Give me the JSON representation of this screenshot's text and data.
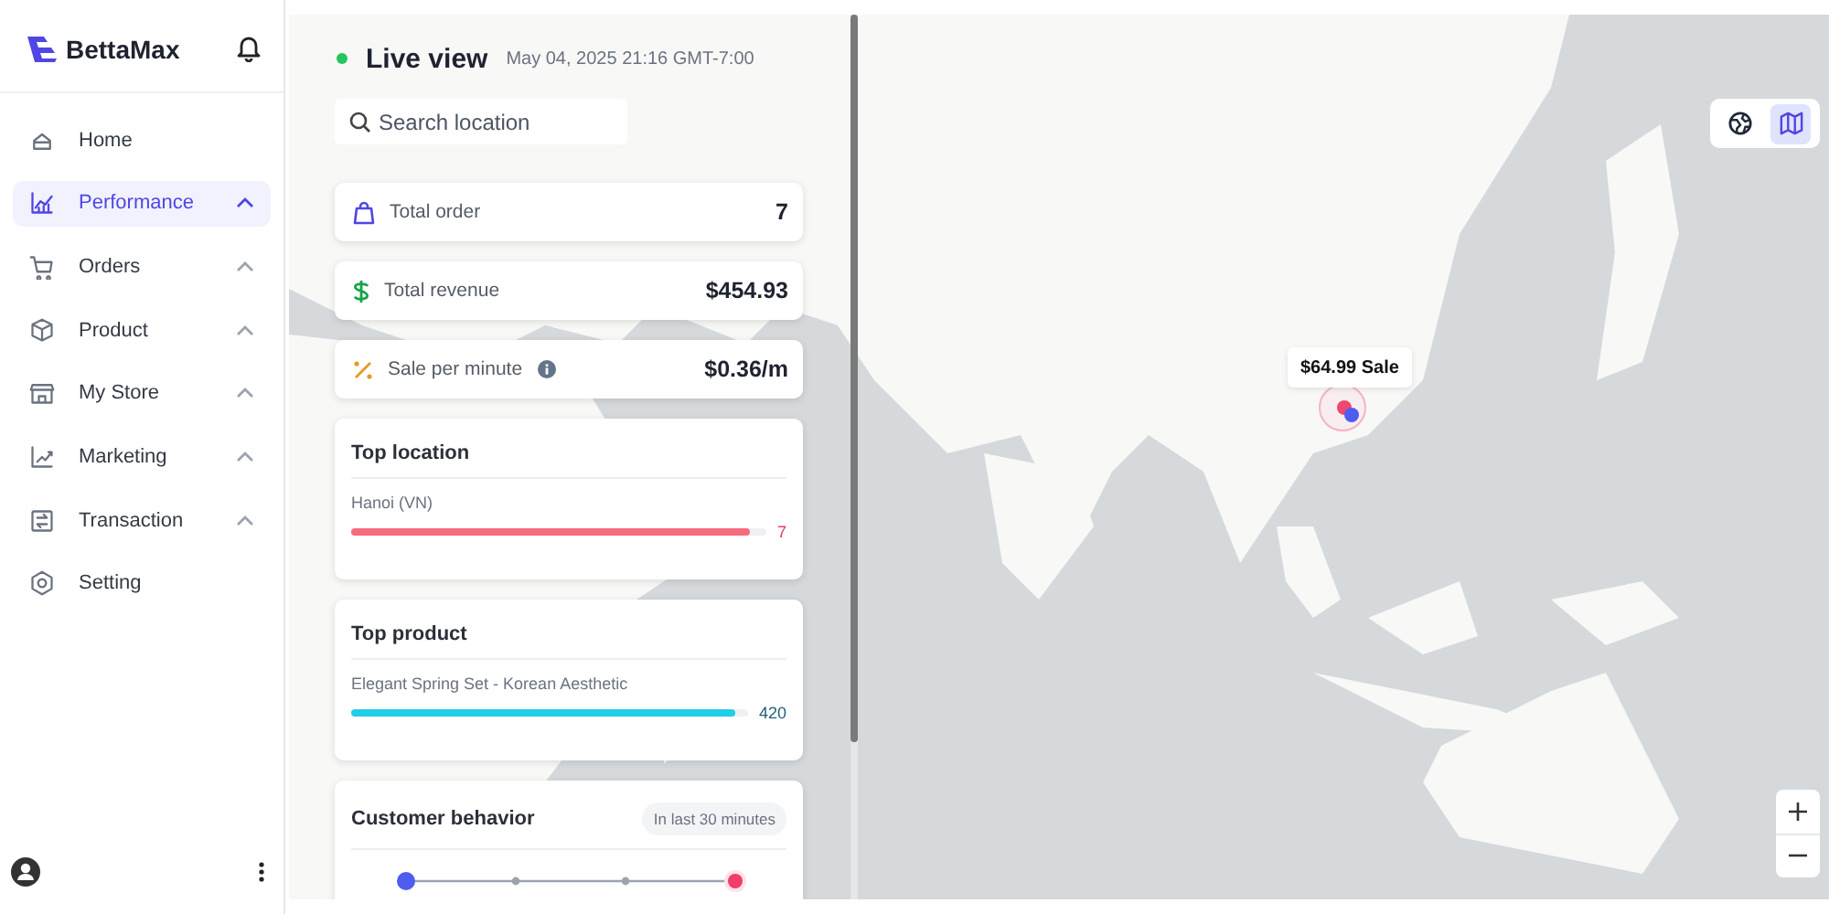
{
  "brand": {
    "name": "BettaMax"
  },
  "nav": [
    {
      "kind": "home",
      "label": "Home",
      "selected": false,
      "expandable": false
    },
    {
      "kind": "chart",
      "label": "Performance",
      "selected": true,
      "expandable": true
    },
    {
      "kind": "cart",
      "label": "Orders",
      "selected": false,
      "expandable": true
    },
    {
      "kind": "box",
      "label": "Product",
      "selected": false,
      "expandable": true
    },
    {
      "kind": "store",
      "label": "My Store",
      "selected": false,
      "expandable": true
    },
    {
      "kind": "marketing",
      "label": "Marketing",
      "selected": false,
      "expandable": true
    },
    {
      "kind": "transaction",
      "label": "Transaction",
      "selected": false,
      "expandable": true
    },
    {
      "kind": "setting",
      "label": "Setting",
      "selected": false,
      "expandable": false
    }
  ],
  "live": {
    "title": "Live view",
    "date": "May 04, 2025 21:16 GMT-7:00",
    "on": true
  },
  "search": {
    "placeholder": "Search location"
  },
  "stats": [
    {
      "kind": "orders",
      "label": "Total order",
      "value": "7",
      "info": false
    },
    {
      "kind": "revenue",
      "label": "Total revenue",
      "value": "$454.93",
      "info": false
    },
    {
      "kind": "rate",
      "label": "Sale per minute",
      "value": "$0.36/m",
      "info": true
    }
  ],
  "top_location": {
    "title": "Top location",
    "items": [
      {
        "name": "Hanoi (VN)",
        "level": 0.96,
        "value": "7"
      }
    ]
  },
  "top_product": {
    "title": "Top product",
    "items": [
      {
        "name": "Elegant Spring Set - Korean Aesthetic",
        "level": 0.97,
        "value": "420"
      }
    ]
  },
  "customer_behavior": {
    "title": "Customer behavior",
    "period": "In last 30 minutes"
  },
  "map": {
    "view_modes": [
      {
        "kind": "globe",
        "selected": false
      },
      {
        "kind": "map",
        "selected": true
      }
    ],
    "sale_popup": "$64.99 Sale"
  }
}
